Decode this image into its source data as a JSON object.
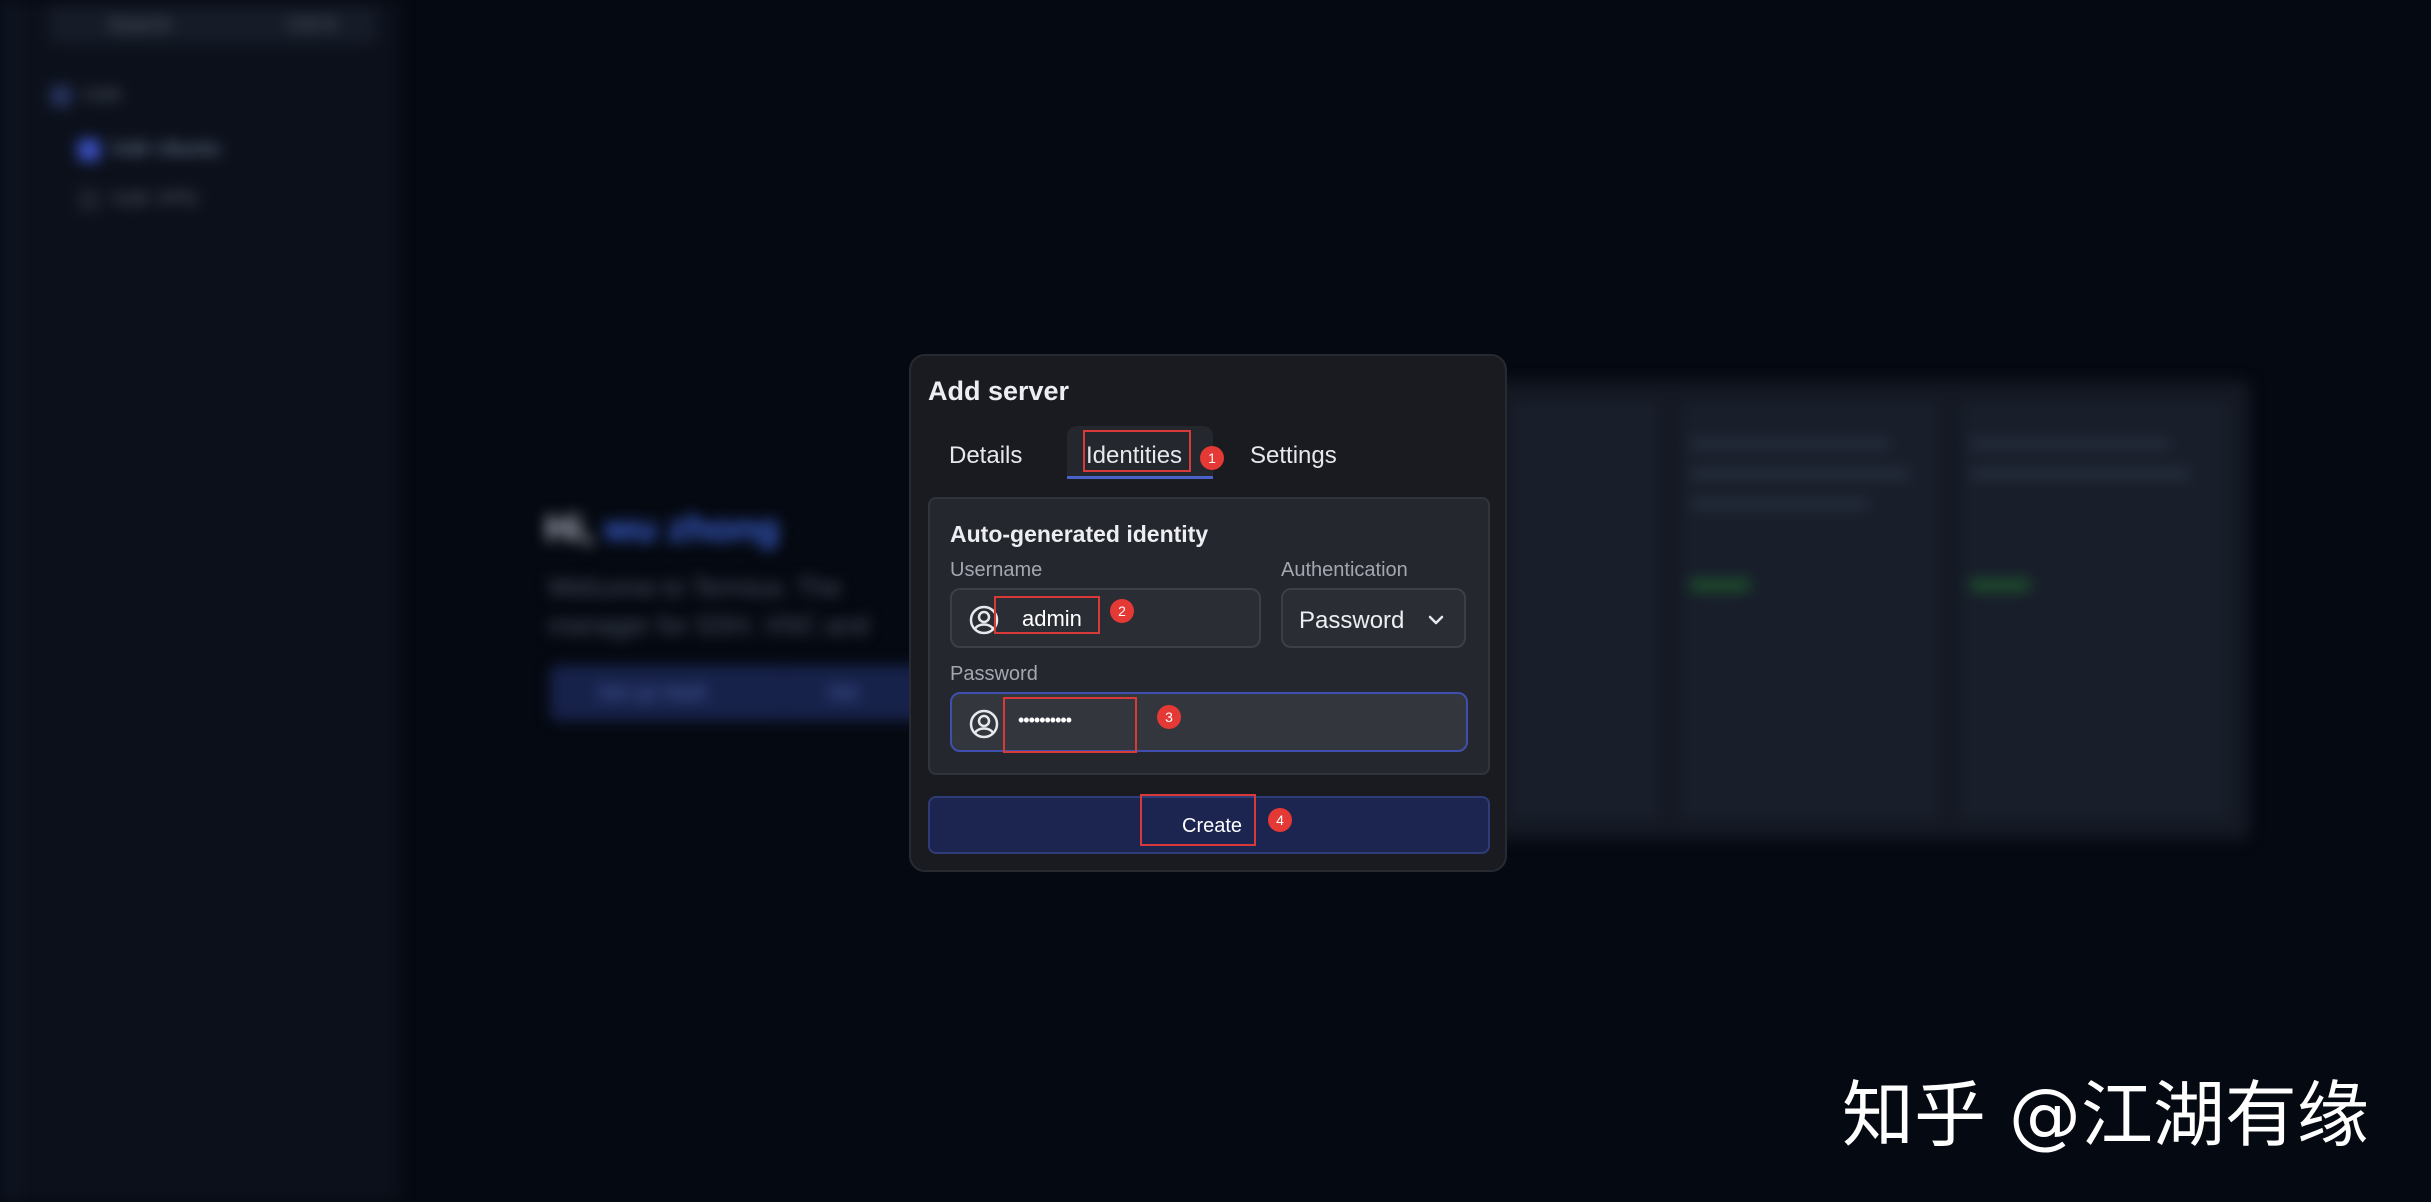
{
  "dialog": {
    "title": "Add server",
    "tabs": [
      {
        "label": "Details"
      },
      {
        "label": "Identities"
      },
      {
        "label": "Settings"
      }
    ],
    "identity_panel": {
      "title": "Auto-generated identity",
      "username": {
        "label": "Username",
        "value": "admin"
      },
      "authentication": {
        "label": "Authentication",
        "value": "Password"
      },
      "password": {
        "label": "Password",
        "value": "••••••••••"
      }
    },
    "create_label": "Create"
  },
  "annotations": [
    "1",
    "2",
    "3",
    "4"
  ],
  "watermark": "知乎 @江湖有缘",
  "colors": {
    "background": "#050911",
    "dialog": "#191b21",
    "accent": "#4a61c9",
    "create_button": "#1c2550",
    "highlight": "#d83a3a",
    "badge": "#e53935"
  },
  "icons": [
    "user-circle-icon",
    "chevron-down-icon"
  ]
}
